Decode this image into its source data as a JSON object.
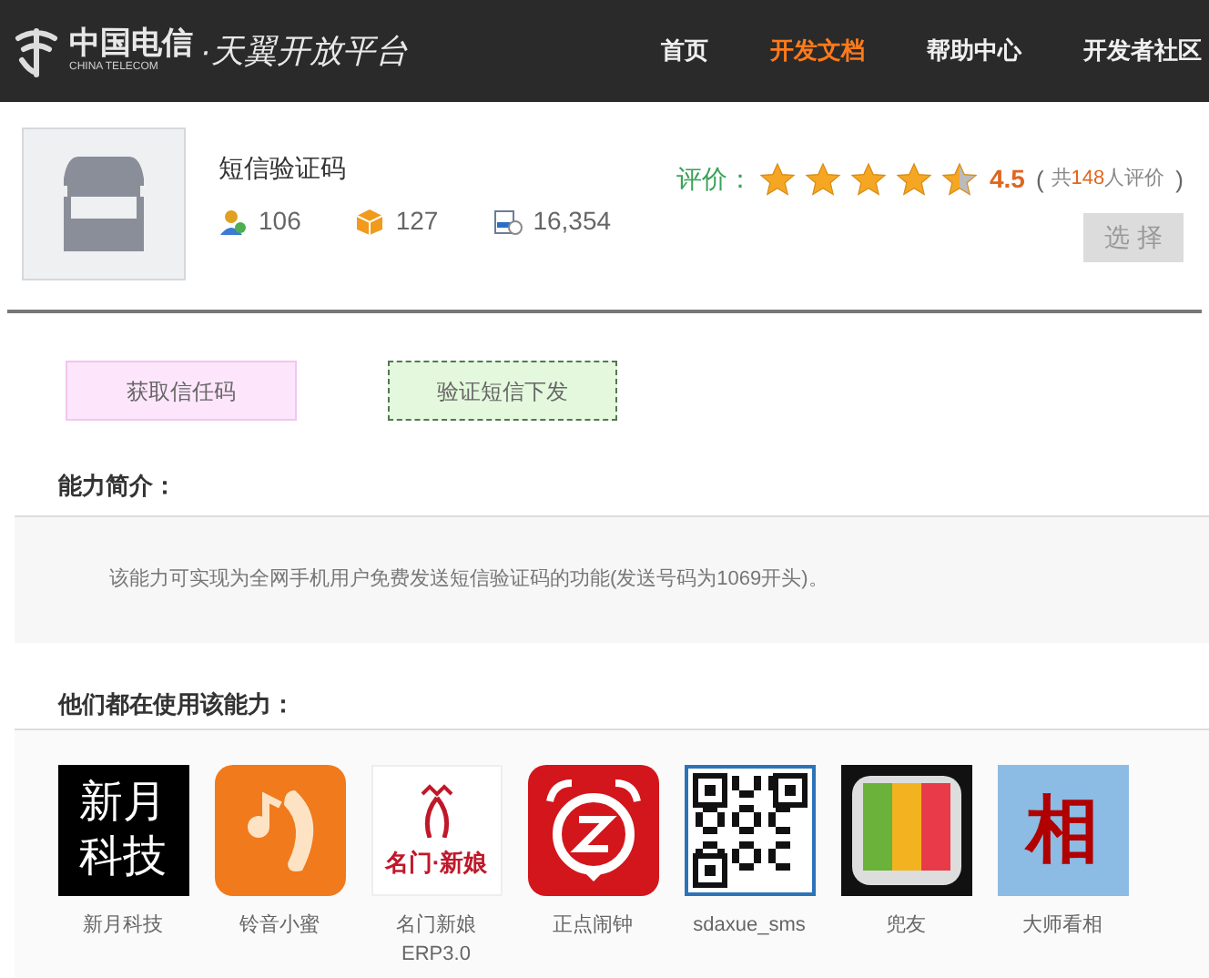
{
  "header": {
    "logo": {
      "cn": "中国电信",
      "en": "CHINA TELECOM",
      "platform": "·天翼开放平台"
    },
    "nav": [
      {
        "label": "首页",
        "selected": false
      },
      {
        "label": "开发文档",
        "selected": true
      },
      {
        "label": "帮助中心",
        "selected": false
      },
      {
        "label": "开发者社区",
        "selected": false
      }
    ]
  },
  "product": {
    "title": "短信验证码",
    "stats": [
      {
        "kind": "users",
        "value": "106"
      },
      {
        "kind": "apps",
        "value": "127"
      },
      {
        "kind": "calls",
        "value": "16,354"
      }
    ],
    "rating_label": "评价：",
    "stars": 4.5,
    "score": "4.5",
    "reviews_open": "(",
    "reviews_pre": "共",
    "reviews_count": "148",
    "reviews_post": "人评价",
    "reviews_close": ")",
    "select_button": "选 择"
  },
  "actions": [
    {
      "label": "获取信任码",
      "kind": "pink"
    },
    {
      "label": "验证短信下发",
      "kind": "green"
    }
  ],
  "intro": {
    "heading": "能力简介：",
    "text": "该能力可实现为全网手机用户免费发送短信验证码的功能(发送号码为1069开头)。"
  },
  "users": {
    "heading": "他们都在使用该能力：",
    "apps": [
      {
        "kind": "text-black",
        "logo_text": [
          "新月",
          "科技"
        ],
        "name": [
          "新月科技"
        ]
      },
      {
        "kind": "phone",
        "name": [
          "铃音小蜜"
        ]
      },
      {
        "kind": "bride",
        "logo_text": [
          "名门·新娘"
        ],
        "name": [
          "名门新娘",
          "ERP3.0"
        ]
      },
      {
        "kind": "alarm",
        "name": [
          "正点闹钟"
        ]
      },
      {
        "kind": "qr",
        "name": [
          "sdaxue_sms"
        ]
      },
      {
        "kind": "stripes",
        "name": [
          "兜友"
        ]
      },
      {
        "kind": "text-blue",
        "logo_text": [
          "相"
        ],
        "name": [
          "大师看相"
        ]
      }
    ]
  }
}
